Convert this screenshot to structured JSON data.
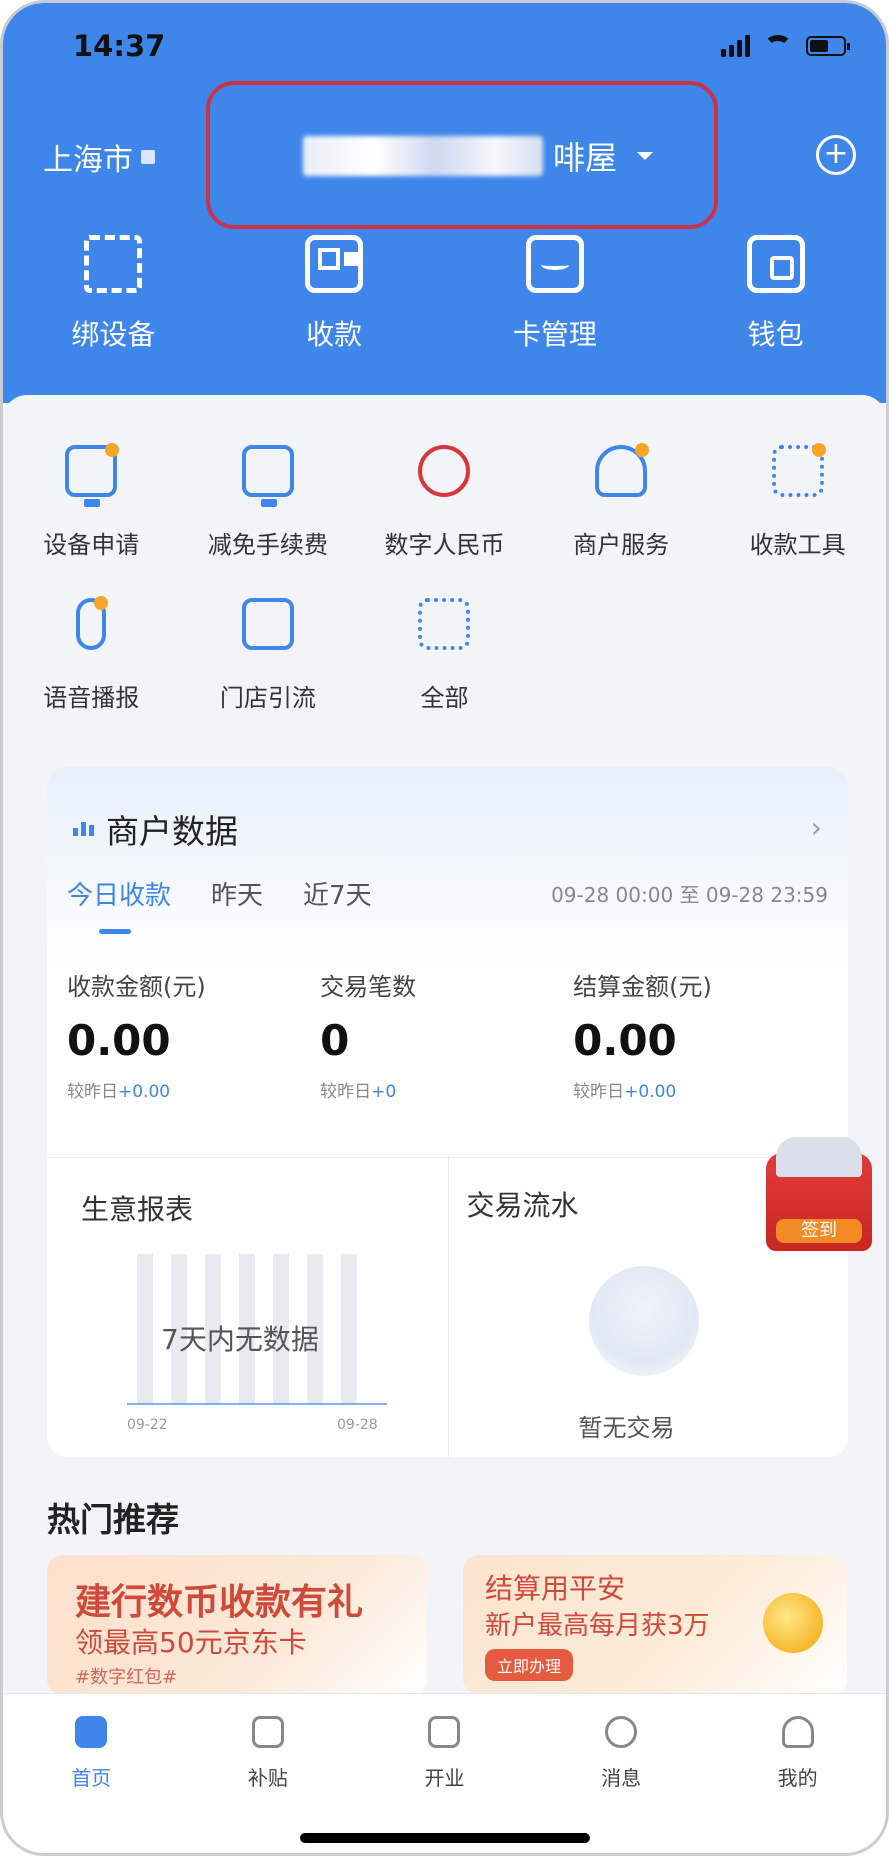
{
  "status_bar": {
    "time": "14:37"
  },
  "header": {
    "city": "上海市",
    "store_name_visible_suffix": "啡屋",
    "quick_actions": [
      {
        "label": "绑设备",
        "icon": "scan-icon"
      },
      {
        "label": "收款",
        "icon": "qr-code-icon"
      },
      {
        "label": "卡管理",
        "icon": "card-icon"
      },
      {
        "label": "钱包",
        "icon": "wallet-icon"
      }
    ]
  },
  "services": [
    {
      "label": "设备申请",
      "icon": "device-icon"
    },
    {
      "label": "减免手续费",
      "icon": "fee-waiver-icon"
    },
    {
      "label": "数字人民币",
      "icon": "digital-rmb-icon"
    },
    {
      "label": "商户服务",
      "icon": "merchant-service-icon"
    },
    {
      "label": "收款工具",
      "icon": "payment-tools-icon"
    },
    {
      "label": "语音播报",
      "icon": "microphone-icon"
    },
    {
      "label": "门店引流",
      "icon": "store-traffic-icon"
    },
    {
      "label": "全部",
      "icon": "all-apps-icon"
    }
  ],
  "merchant_data": {
    "title": "商户数据",
    "tabs": [
      "今日收款",
      "昨天",
      "近7天"
    ],
    "active_tab": "今日收款",
    "range": "09-28 00:00 至 09-28 23:59",
    "metrics": [
      {
        "label": "收款金额(元)",
        "value": "0.00",
        "compare_prefix": "较昨日",
        "compare": "+0.00"
      },
      {
        "label": "交易笔数",
        "value": "0",
        "compare_prefix": "较昨日",
        "compare": "+0"
      },
      {
        "label": "结算金额(元)",
        "value": "0.00",
        "compare_prefix": "较昨日",
        "compare": "+0.00"
      }
    ],
    "report_title": "生意报表",
    "report_empty": "7天内无数据",
    "report_x_start": "09-22",
    "report_x_end": "09-28",
    "flow_title": "交易流水",
    "flow_empty": "暂无交易"
  },
  "float_badge": {
    "label": "签到"
  },
  "hot": {
    "title": "热门推荐",
    "promo1": {
      "line1": "建行数币收款有礼",
      "line2": "领最高50元京东卡",
      "line3": "#数字红包#"
    },
    "promo2": {
      "line1": "结算用平安",
      "line2": "新户最高每月获3万",
      "button": "立即办理"
    }
  },
  "bottom_nav": [
    {
      "label": "首页",
      "icon": "home-icon",
      "active": true
    },
    {
      "label": "补贴",
      "icon": "subsidy-icon",
      "active": false
    },
    {
      "label": "开业",
      "icon": "open-store-icon",
      "active": false
    },
    {
      "label": "消息",
      "icon": "message-icon",
      "active": false
    },
    {
      "label": "我的",
      "icon": "profile-icon",
      "active": false
    }
  ],
  "colors": {
    "brand_blue": "#3f86ea",
    "highlight_red": "#c9334a",
    "promo_red": "#d04a3c"
  }
}
